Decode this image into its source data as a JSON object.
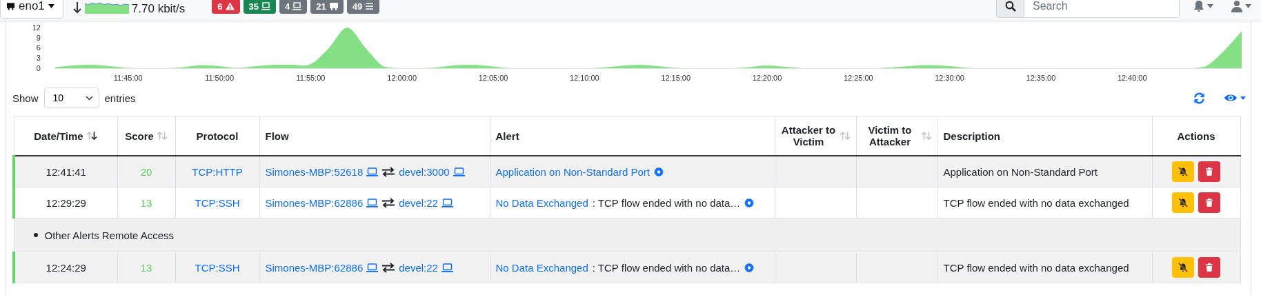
{
  "navbar": {
    "interface": "eno1",
    "throughput": "7.70 kbit/s",
    "badges": [
      {
        "kind": "alerts",
        "count": "6",
        "color": "#dc3545"
      },
      {
        "kind": "local-hosts",
        "count": "35",
        "color": "#198754"
      },
      {
        "kind": "remote-hosts",
        "count": "4",
        "color": "#6c757d"
      },
      {
        "kind": "devices",
        "count": "21",
        "color": "#6c757d"
      },
      {
        "kind": "flows",
        "count": "49",
        "color": "#6c757d"
      }
    ],
    "search": {
      "placeholder": "Search"
    }
  },
  "chart": {
    "chart_data": {
      "type": "area",
      "categories": [
        null,
        null,
        null,
        null,
        "11:45:00",
        null,
        null,
        null,
        null,
        "11:50:00",
        null,
        null,
        null,
        null,
        "11:55:00",
        null,
        null,
        null,
        null,
        "12:00:00",
        null,
        null,
        null,
        null,
        "12:05:00",
        null,
        null,
        null,
        null,
        "12:10:00",
        null,
        null,
        null,
        null,
        "12:15:00",
        null,
        null,
        null,
        null,
        "12:20:00",
        null,
        null,
        null,
        null,
        "12:25:00",
        null,
        null,
        null,
        null,
        "12:30:00",
        null,
        null,
        null,
        null,
        "12:35:00",
        null,
        null,
        null,
        null,
        "12:40:00",
        null,
        null,
        null,
        null,
        null,
        null
      ],
      "series": [
        {
          "color": "#85e085",
          "values": [
            0.3,
            0.8,
            1,
            0.6,
            0.1,
            0,
            0,
            0.3,
            0.9,
            0.6,
            0.1,
            0.6,
            1,
            1,
            1.2,
            6,
            12,
            6,
            0.5,
            0,
            0,
            0.3,
            0.9,
            1,
            0.5,
            0,
            0,
            0,
            0,
            0,
            0.2,
            0.7,
            1,
            0.6,
            0.1,
            0,
            0,
            0,
            0.3,
            0.8,
            0.4,
            0,
            0,
            0,
            0,
            0,
            0.3,
            0.7,
            0.9,
            0.6,
            0.1,
            0,
            0,
            0,
            0,
            0,
            0,
            0,
            0,
            0,
            0,
            0,
            0,
            0.5,
            5,
            11
          ]
        }
      ],
      "ylim": [
        0,
        12
      ],
      "yticks": [
        0,
        3,
        6,
        9,
        12
      ]
    }
  },
  "table_controls": {
    "show_label": "Show",
    "page_size": "10",
    "entries_label": "entries"
  },
  "table": {
    "columns": [
      {
        "label": "Date/Time",
        "sortable": true,
        "sorted": true
      },
      {
        "label": "Score",
        "sortable": true,
        "sorted": false
      },
      {
        "label": "Protocol"
      },
      {
        "label": "Flow"
      },
      {
        "label": "Alert"
      },
      {
        "label": "Attacker to Victim",
        "sortable": true,
        "sorted": false
      },
      {
        "label": "Victim to Attacker",
        "sortable": true,
        "sorted": false
      },
      {
        "label": "Description"
      },
      {
        "label": "Actions"
      }
    ],
    "rows": [
      {
        "kind": "alert",
        "time": "12:41:41",
        "score": "20",
        "protocol": "TCP:HTTP",
        "client": "Simones-MBP:52618",
        "server": "devel:3000",
        "alert": "Application on Non-Standard Port",
        "description": "Application on Non-Standard Port"
      },
      {
        "kind": "alert",
        "time": "12:29:29",
        "score": "13",
        "protocol": "TCP:SSH",
        "client": "Simones-MBP:62886",
        "server": "devel:22",
        "alert": "No Data Exchanged",
        "alert_detail": ": TCP flow ended with no data…",
        "description": "TCP flow ended with no data exchanged"
      },
      {
        "kind": "group",
        "label": "Other Alerts Remote Access"
      },
      {
        "kind": "alert",
        "time": "12:24:29",
        "score": "13",
        "protocol": "TCP:SSH",
        "client": "Simones-MBP:62886",
        "server": "devel:22",
        "alert": "No Data Exchanged",
        "alert_detail": ": TCP flow ended with no data…",
        "description": "TCP flow ended with no data exchanged"
      }
    ]
  }
}
